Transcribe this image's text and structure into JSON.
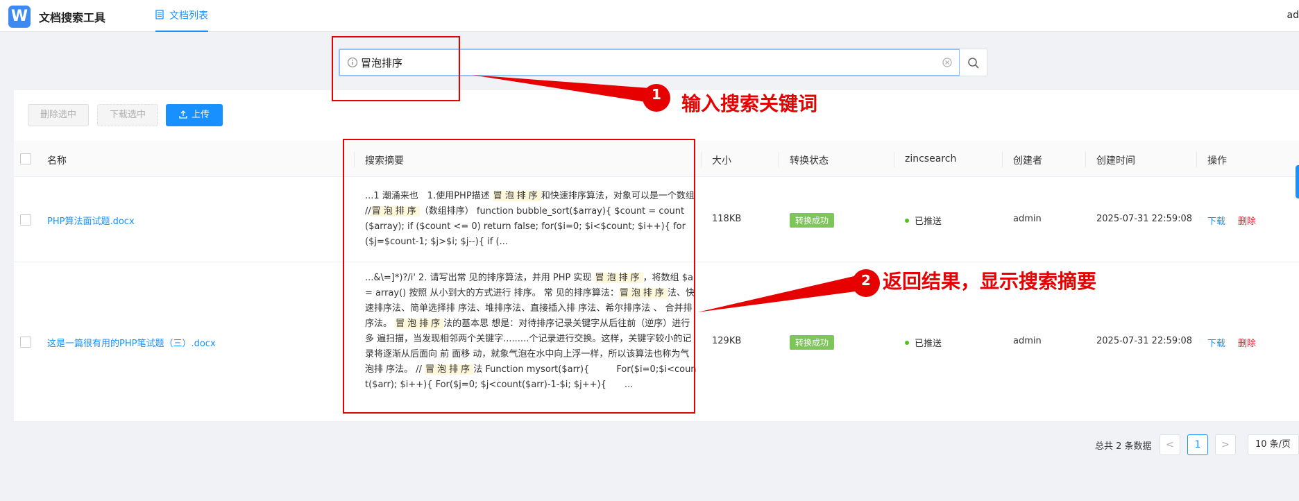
{
  "header": {
    "logo_letter": "W",
    "app_title": "文档搜索工具",
    "nav_tab": "文档列表",
    "user_fragment": "ad"
  },
  "search": {
    "value": "冒泡排序",
    "placeholder": ""
  },
  "toolbar": {
    "delete_selected": "删除选中",
    "download_selected": "下载选中",
    "upload": "上传"
  },
  "table": {
    "columns": [
      "名称",
      "搜索摘要",
      "大小",
      "转换状态",
      "zincsearch",
      "创建者",
      "创建时间",
      "操作"
    ],
    "rows": [
      {
        "name": "PHP算法面试题.docx",
        "summary": [
          {
            "t": "...1 潮涌来也　1.使用PHP描述 ",
            "h": false
          },
          {
            "t": "冒泡排序",
            "h": true
          },
          {
            "t": "和快速排序算法，对象可以是一个数组 //",
            "h": false
          },
          {
            "t": "冒泡排序",
            "h": true
          },
          {
            "t": "（数组排序）  function bubble_sort($array){ $count = count($array); if ($count <= 0) return false; for($i=0; $i<$count; $i++){ for($j=$count-1; $j>$i; $j--){ if (...",
            "h": false
          }
        ],
        "size": "118KB",
        "status": "转换成功",
        "zinc": "已推送",
        "creator": "admin",
        "created": "2025-07-31 22:59:08",
        "action_download": "下载",
        "action_delete": "删除"
      },
      {
        "name": "这是一篇很有用的PHP笔试题（三）.docx",
        "summary": [
          {
            "t": "...&\\=]*)?/i' 2. 请写出常 见的排序算法，并用 PHP 实现 ",
            "h": false
          },
          {
            "t": "冒泡排序",
            "h": true
          },
          {
            "t": "，将数组 $a = array() 按照 从小到大的方式进行 排序。 常 见的排序算法：",
            "h": false
          },
          {
            "t": "冒泡排序",
            "h": true
          },
          {
            "t": "法、快速排序法、简单选择排 序法、堆排序法、直接插入排 序法、希尔排序法 、 合并排 序法。 ",
            "h": false
          },
          {
            "t": "冒泡排序",
            "h": true
          },
          {
            "t": "法的基本思 想是：对待排序记录关键字从后往前（逆序）进行多 遍扫描，当发现相邻两个关键字.........个记录进行交换。这样，关键字较小的记录将逐渐从后面向 前 面移 动，就象气泡在水中向上浮一样，所以该算法也称为气泡排 序法。 // ",
            "h": false
          },
          {
            "t": "冒泡排序",
            "h": true
          },
          {
            "t": "法 Function mysort($arr){　　　For($i=0;$i<count($arr); $i++){ For($j=0; $j<count($arr)-1-$i; $j++){　　...",
            "h": false
          }
        ],
        "size": "129KB",
        "status": "转换成功",
        "zinc": "已推送",
        "creator": "admin",
        "created": "2025-07-31 22:59:08",
        "action_download": "下载",
        "action_delete": "删除"
      }
    ]
  },
  "pagination": {
    "total": "总共 2 条数据",
    "prev": "<",
    "current": "1",
    "next": ">",
    "page_size": "10 条/页"
  },
  "annotations": {
    "step1_num": "1",
    "step1_text": "输入搜索关键词",
    "step2_num": "2",
    "step2_text": "返回结果，显示搜索摘要"
  },
  "colors": {
    "primary": "#1890ff",
    "danger": "#f5222d",
    "success": "#7ec55a",
    "annotation": "#e60000",
    "highlight": "#fff7d9"
  }
}
